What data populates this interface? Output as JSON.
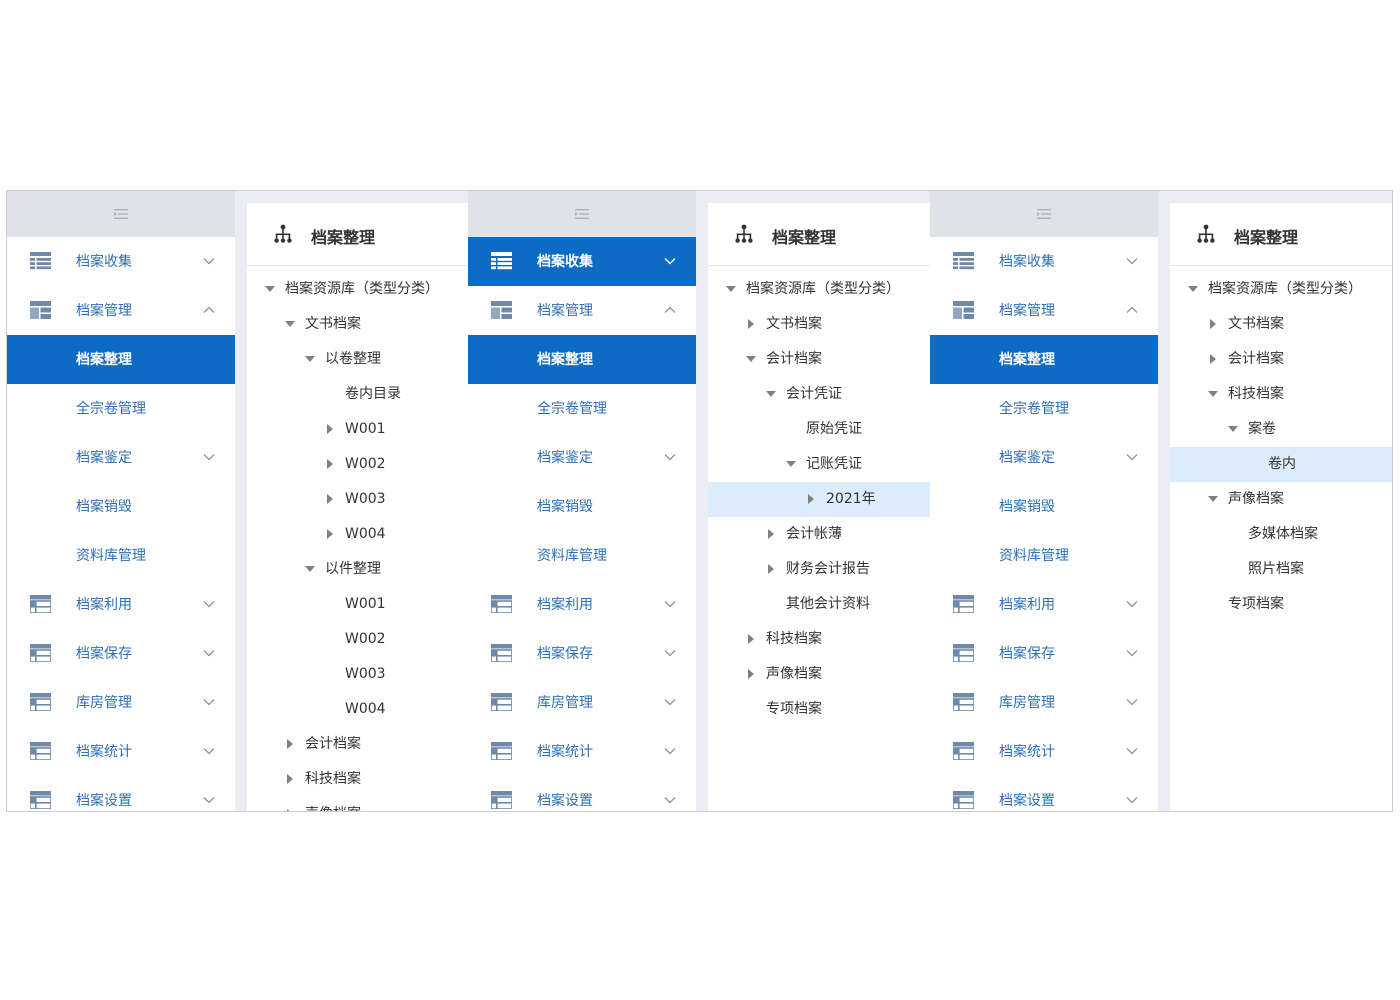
{
  "colors": {
    "accent": "#0c6cc5",
    "menu_text": "#2e6fb5",
    "selected_row": "#dcecfb",
    "collapse_bar": "#dfe3e8"
  },
  "panels": [
    {
      "menu": [
        {
          "label": "档案收集",
          "icon": "list-table-icon",
          "expand": "chevron-down",
          "level": 1
        },
        {
          "label": "档案管理",
          "icon": "header-table-icon",
          "expand": "chevron-up",
          "level": 1
        },
        {
          "label": "档案整理",
          "level": 2,
          "active": true
        },
        {
          "label": "全宗卷管理",
          "level": 2
        },
        {
          "label": "档案鉴定",
          "level": 2,
          "expand": "chevron-down"
        },
        {
          "label": "档案销毁",
          "level": 2
        },
        {
          "label": "资料库管理",
          "level": 2
        },
        {
          "label": "档案利用",
          "icon": "grid-table-icon",
          "expand": "chevron-down",
          "level": 1
        },
        {
          "label": "档案保存",
          "icon": "grid-table-icon",
          "expand": "chevron-down",
          "level": 1
        },
        {
          "label": "库房管理",
          "icon": "grid-table-icon",
          "expand": "chevron-down",
          "level": 1
        },
        {
          "label": "档案统计",
          "icon": "grid-table-icon",
          "expand": "chevron-down",
          "level": 1
        },
        {
          "label": "档案设置",
          "icon": "grid-table-icon",
          "expand": "chevron-down",
          "level": 1
        }
      ],
      "tree_title": "档案整理",
      "tree": [
        {
          "label": "档案资源库（类型分类）",
          "depth": 0,
          "state": "open"
        },
        {
          "label": "文书档案",
          "depth": 1,
          "state": "open"
        },
        {
          "label": "以卷整理",
          "depth": 2,
          "state": "open"
        },
        {
          "label": "卷内目录",
          "depth": 3,
          "state": "leaf"
        },
        {
          "label": "W001",
          "depth": 3,
          "state": "closed"
        },
        {
          "label": "W002",
          "depth": 3,
          "state": "closed"
        },
        {
          "label": "W003",
          "depth": 3,
          "state": "closed"
        },
        {
          "label": "W004",
          "depth": 3,
          "state": "closed"
        },
        {
          "label": "以件整理",
          "depth": 2,
          "state": "open"
        },
        {
          "label": "W001",
          "depth": 3,
          "state": "leaf"
        },
        {
          "label": "W002",
          "depth": 3,
          "state": "leaf"
        },
        {
          "label": "W003",
          "depth": 3,
          "state": "leaf"
        },
        {
          "label": "W004",
          "depth": 3,
          "state": "leaf"
        },
        {
          "label": "会计档案",
          "depth": 1,
          "state": "closed"
        },
        {
          "label": "科技档案",
          "depth": 1,
          "state": "closed"
        },
        {
          "label": "声像档案",
          "depth": 1,
          "state": "closed"
        }
      ]
    },
    {
      "menu": [
        {
          "label": "档案收集",
          "icon": "list-table-icon",
          "expand": "chevron-down",
          "level": 1,
          "active": true
        },
        {
          "label": "档案管理",
          "icon": "header-table-icon",
          "expand": "chevron-up",
          "level": 1
        },
        {
          "label": "档案整理",
          "level": 2,
          "active": true
        },
        {
          "label": "全宗卷管理",
          "level": 2
        },
        {
          "label": "档案鉴定",
          "level": 2,
          "expand": "chevron-down"
        },
        {
          "label": "档案销毁",
          "level": 2
        },
        {
          "label": "资料库管理",
          "level": 2
        },
        {
          "label": "档案利用",
          "icon": "grid-table-icon",
          "expand": "chevron-down",
          "level": 1
        },
        {
          "label": "档案保存",
          "icon": "grid-table-icon",
          "expand": "chevron-down",
          "level": 1
        },
        {
          "label": "库房管理",
          "icon": "grid-table-icon",
          "expand": "chevron-down",
          "level": 1
        },
        {
          "label": "档案统计",
          "icon": "grid-table-icon",
          "expand": "chevron-down",
          "level": 1
        },
        {
          "label": "档案设置",
          "icon": "grid-table-icon",
          "expand": "chevron-down",
          "level": 1
        }
      ],
      "tree_title": "档案整理",
      "tree": [
        {
          "label": "档案资源库（类型分类）",
          "depth": 0,
          "state": "open"
        },
        {
          "label": "文书档案",
          "depth": 1,
          "state": "closed"
        },
        {
          "label": "会计档案",
          "depth": 1,
          "state": "open"
        },
        {
          "label": "会计凭证",
          "depth": 2,
          "state": "open"
        },
        {
          "label": "原始凭证",
          "depth": 3,
          "state": "leaf"
        },
        {
          "label": "记账凭证",
          "depth": 3,
          "state": "open"
        },
        {
          "label": "2021年",
          "depth": 4,
          "state": "closed",
          "selected": true
        },
        {
          "label": "会计帐薄",
          "depth": 2,
          "state": "closed"
        },
        {
          "label": "财务会计报告",
          "depth": 2,
          "state": "closed"
        },
        {
          "label": "其他会计资料",
          "depth": 2,
          "state": "leaf"
        },
        {
          "label": "科技档案",
          "depth": 1,
          "state": "closed"
        },
        {
          "label": "声像档案",
          "depth": 1,
          "state": "closed"
        },
        {
          "label": "专项档案",
          "depth": 1,
          "state": "leaf"
        }
      ]
    },
    {
      "menu": [
        {
          "label": "档案收集",
          "icon": "list-table-icon",
          "expand": "chevron-down",
          "level": 1
        },
        {
          "label": "档案管理",
          "icon": "header-table-icon",
          "expand": "chevron-up",
          "level": 1
        },
        {
          "label": "档案整理",
          "level": 2,
          "active": true
        },
        {
          "label": "全宗卷管理",
          "level": 2
        },
        {
          "label": "档案鉴定",
          "level": 2,
          "expand": "chevron-down"
        },
        {
          "label": "档案销毁",
          "level": 2
        },
        {
          "label": "资料库管理",
          "level": 2
        },
        {
          "label": "档案利用",
          "icon": "grid-table-icon",
          "expand": "chevron-down",
          "level": 1
        },
        {
          "label": "档案保存",
          "icon": "grid-table-icon",
          "expand": "chevron-down",
          "level": 1
        },
        {
          "label": "库房管理",
          "icon": "grid-table-icon",
          "expand": "chevron-down",
          "level": 1
        },
        {
          "label": "档案统计",
          "icon": "grid-table-icon",
          "expand": "chevron-down",
          "level": 1
        },
        {
          "label": "档案设置",
          "icon": "grid-table-icon",
          "expand": "chevron-down",
          "level": 1
        }
      ],
      "tree_title": "档案整理",
      "tree": [
        {
          "label": "档案资源库（类型分类）",
          "depth": 0,
          "state": "open"
        },
        {
          "label": "文书档案",
          "depth": 1,
          "state": "closed"
        },
        {
          "label": "会计档案",
          "depth": 1,
          "state": "closed"
        },
        {
          "label": "科技档案",
          "depth": 1,
          "state": "open"
        },
        {
          "label": "案卷",
          "depth": 2,
          "state": "open"
        },
        {
          "label": "卷内",
          "depth": 3,
          "state": "leaf",
          "selected": true
        },
        {
          "label": "声像档案",
          "depth": 1,
          "state": "open"
        },
        {
          "label": "多媒体档案",
          "depth": 2,
          "state": "leaf"
        },
        {
          "label": "照片档案",
          "depth": 2,
          "state": "leaf"
        },
        {
          "label": "专项档案",
          "depth": 1,
          "state": "leaf"
        }
      ]
    }
  ]
}
